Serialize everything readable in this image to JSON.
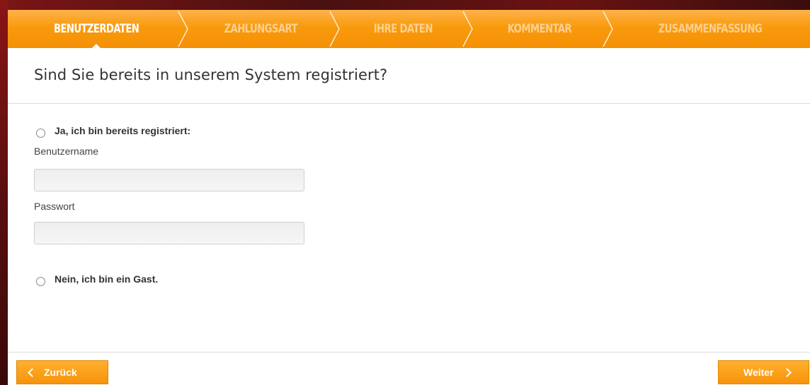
{
  "steps": [
    {
      "label": "BENUTZERDATEN",
      "active": true
    },
    {
      "label": "ZAHLUNGSART",
      "active": false
    },
    {
      "label": "IHRE DATEN",
      "active": false
    },
    {
      "label": "KOMMENTAR",
      "active": false
    },
    {
      "label": "ZUSAMMENFASSUNG",
      "active": false
    }
  ],
  "heading": "Sind Sie bereits in unserem System registriert?",
  "option_registered": {
    "label": "Ja, ich bin bereits registriert:",
    "checked": false
  },
  "username": {
    "label": "Benutzername",
    "value": ""
  },
  "password": {
    "label": "Passwort",
    "value": ""
  },
  "option_guest": {
    "label": "Nein, ich bin ein Gast.",
    "checked": false
  },
  "buttons": {
    "back": {
      "label": "Zurück",
      "icon": "chevron-left-icon"
    },
    "next": {
      "label": "Weiter",
      "icon": "chevron-right-icon"
    }
  },
  "colors": {
    "accent": "#f99a0c",
    "step_active_text": "#ffffff",
    "step_inactive_text": "#fcd08f"
  }
}
